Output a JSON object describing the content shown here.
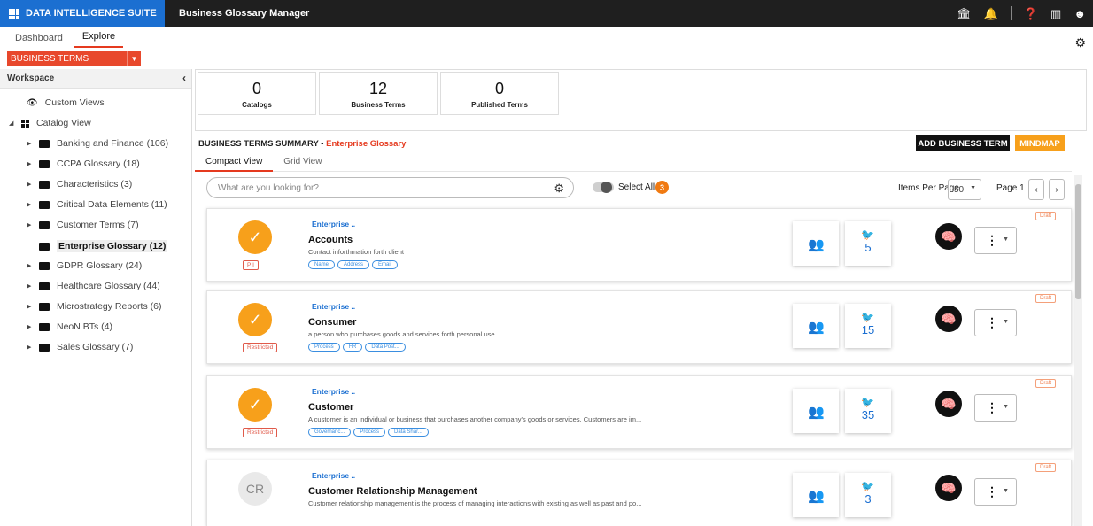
{
  "app": {
    "brand": "DATA INTELLIGENCE SUITE",
    "title": "Business Glossary Manager"
  },
  "topicons": [
    "bank-icon",
    "bell-icon",
    "help-icon",
    "chart-icon",
    "user-icon"
  ],
  "subnav": {
    "tabs": [
      "Dashboard",
      "Explore"
    ],
    "active": "Explore"
  },
  "selector": {
    "value": "BUSINESS TERMS"
  },
  "sidebar": {
    "header": "Workspace",
    "custom_views": "Custom Views",
    "catalog_view": "Catalog View",
    "items": [
      {
        "label": "Banking and Finance (106)"
      },
      {
        "label": "CCPA Glossary (18)"
      },
      {
        "label": "Characteristics (3)"
      },
      {
        "label": "Critical Data Elements (11)"
      },
      {
        "label": "Customer Terms (7)"
      },
      {
        "label": "Enterprise Glossary (12)"
      },
      {
        "label": "GDPR Glossary (24)"
      },
      {
        "label": "Healthcare Glossary (44)"
      },
      {
        "label": "Microstrategy Reports (6)"
      },
      {
        "label": "NeoN BTs (4)"
      },
      {
        "label": "Sales Glossary (7)"
      }
    ]
  },
  "stats": [
    {
      "value": "0",
      "label": "Catalogs"
    },
    {
      "value": "12",
      "label": "Business Terms"
    },
    {
      "value": "0",
      "label": "Published Terms"
    }
  ],
  "summary": {
    "prefix": "BUSINESS TERMS SUMMARY - ",
    "glossary": "Enterprise Glossary"
  },
  "actions": {
    "add": "ADD BUSINESS TERM",
    "mindmap": "MINDMAP"
  },
  "views": [
    "Compact View",
    "Grid View"
  ],
  "search": {
    "placeholder": "What are you looking for?"
  },
  "select_all": {
    "label": "Select All",
    "count": "3"
  },
  "pagination": {
    "items_label": "Items Per Page",
    "items_value": "50",
    "page_label": "Page 1"
  },
  "cards": [
    {
      "avatar": "✓",
      "tag": "PII",
      "category": "Enterprise ..",
      "title": "Accounts",
      "desc": "Contact inforthmation forth client",
      "chips": [
        "Name",
        "Address",
        "Email"
      ],
      "count": "5",
      "status": "Draft"
    },
    {
      "avatar": "✓",
      "tag": "Restricted",
      "category": "Enterprise ..",
      "title": "Consumer",
      "desc": "a person who purchases goods and services forth personal use.",
      "chips": [
        "Process",
        "HR",
        "Data Post..."
      ],
      "count": "15",
      "status": "Draft"
    },
    {
      "avatar": "✓",
      "tag": "Restricted",
      "category": "Enterprise ..",
      "title": "Customer",
      "desc": "A customer is an individual or business that purchases another company's goods or services. Customers are im...",
      "chips": [
        "Governanc...",
        "Process",
        "Data Shar..."
      ],
      "count": "35",
      "status": "Draft"
    },
    {
      "avatar": "CR",
      "tag": "",
      "category": "Enterprise ..",
      "title": "Customer Relationship Management",
      "desc": "Customer relationship management is the process of managing interactions with existing as well as past and po...",
      "chips": [],
      "count": "3",
      "status": "Draft"
    }
  ],
  "colors": {
    "brand": "#1b6fd1",
    "accent": "#e53a1f",
    "orange": "#f7a01b",
    "topbar": "#1f1f1f"
  }
}
